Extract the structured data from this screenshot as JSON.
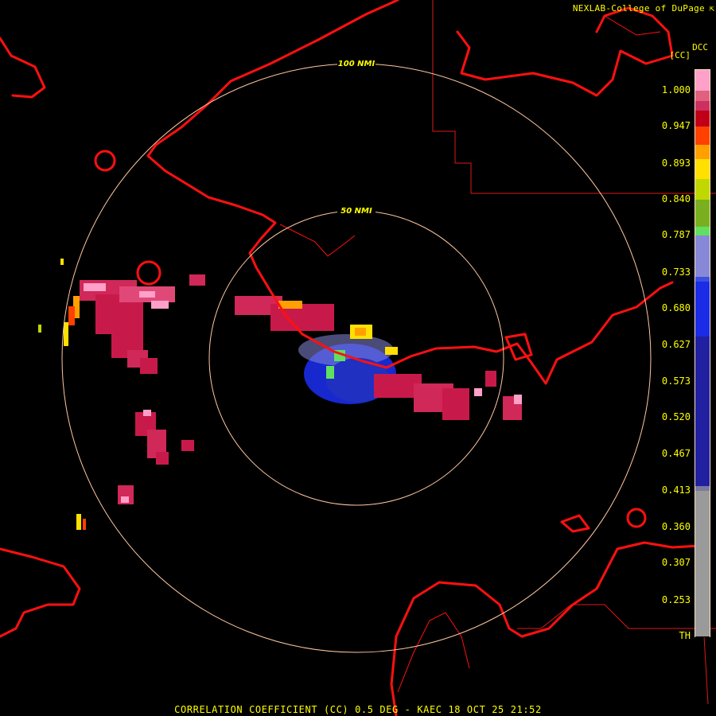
{
  "header": {
    "credit": "NEXLAB-College of DuPage",
    "credit_mark": "⇱"
  },
  "legend": {
    "product_code": "DCC",
    "unit": "[CC]",
    "labels": [
      "1.000",
      "0.947",
      "0.893",
      "0.840",
      "0.787",
      "0.733",
      "0.680",
      "0.627",
      "0.573",
      "0.520",
      "0.467",
      "0.413",
      "0.360",
      "0.307",
      "0.253",
      "TH"
    ],
    "label_values": [
      1.0,
      0.947,
      0.893,
      0.84,
      0.787,
      0.733,
      0.68,
      0.627,
      0.573,
      0.52,
      0.467,
      0.413,
      0.36,
      0.307,
      0.253,
      0.2
    ],
    "bands": [
      {
        "to": 0.2,
        "color": "#000000"
      },
      {
        "to": 0.413,
        "color": "#9a9a9a"
      },
      {
        "to": 0.42,
        "color": "#7a7aa0"
      },
      {
        "to": 0.64,
        "color": "#2020a0"
      },
      {
        "to": 0.72,
        "color": "#1a2ce6"
      },
      {
        "to": 0.727,
        "color": "#3a50e0"
      },
      {
        "to": 0.787,
        "color": "#8888d8"
      },
      {
        "to": 0.8,
        "color": "#60e060"
      },
      {
        "to": 0.84,
        "color": "#7ab020"
      },
      {
        "to": 0.87,
        "color": "#c0d800"
      },
      {
        "to": 0.9,
        "color": "#ffe000"
      },
      {
        "to": 0.92,
        "color": "#ffa000"
      },
      {
        "to": 0.947,
        "color": "#ff4000"
      },
      {
        "to": 0.97,
        "color": "#c00018"
      },
      {
        "to": 0.985,
        "color": "#cc3060"
      },
      {
        "to": 1.0,
        "color": "#e06080"
      },
      {
        "to": 1.03,
        "color": "#ffa0c8"
      }
    ]
  },
  "map": {
    "range_rings": [
      {
        "label": "50 NMI",
        "range_nmi": 50
      },
      {
        "label": "100 NMI",
        "range_nmi": 100
      }
    ],
    "colors": {
      "coast": "#ff1010",
      "border": "#e01818",
      "ring": "#ffc8a0",
      "ring_label": "#ffff00"
    }
  },
  "footer": {
    "product_line": "CORRELATION COEFFICIENT (CC) 0.5 DEG - KAEC 18 OCT 25 21:52"
  }
}
